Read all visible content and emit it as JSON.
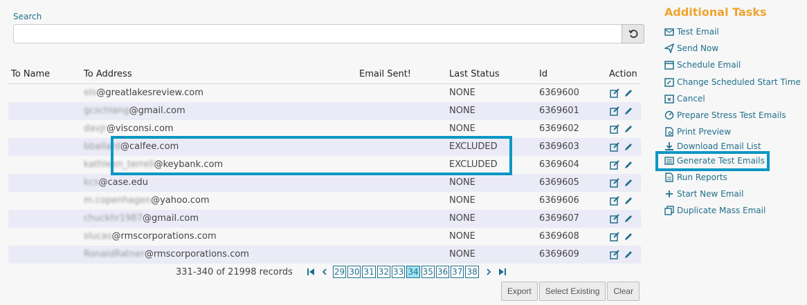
{
  "search": {
    "label": "Search",
    "value": "",
    "placeholder": ""
  },
  "table": {
    "headers": [
      "To Name",
      "To Address",
      "Email Sent!",
      "Last Status",
      "Id",
      "Action"
    ],
    "rows": [
      {
        "name": "",
        "blurred": "els",
        "domain": "@greatlakesreview.com",
        "sent": "",
        "status": "NONE",
        "id": "6369600"
      },
      {
        "name": "",
        "blurred": "gcschlang",
        "domain": "@gmail.com",
        "sent": "",
        "status": "NONE",
        "id": "6369601"
      },
      {
        "name": "",
        "blurred": "davjr",
        "domain": "@visconsi.com",
        "sent": "",
        "status": "NONE",
        "id": "6369602"
      },
      {
        "name": "",
        "blurred": "bballard",
        "domain": "@calfee.com",
        "sent": "",
        "status": "EXCLUDED",
        "id": "6369603"
      },
      {
        "name": "",
        "blurred": "kathleen_terrell",
        "domain": "@keybank.com",
        "sent": "",
        "status": "EXCLUDED",
        "id": "6369604"
      },
      {
        "name": "",
        "blurred": "kcs",
        "domain": "@case.edu",
        "sent": "",
        "status": "NONE",
        "id": "6369605"
      },
      {
        "name": "",
        "blurred": "m.copenhagen",
        "domain": "@yahoo.com",
        "sent": "",
        "status": "NONE",
        "id": "6369606"
      },
      {
        "name": "",
        "blurred": "chuckhr1987",
        "domain": "@gmail.com",
        "sent": "",
        "status": "NONE",
        "id": "6369607"
      },
      {
        "name": "",
        "blurred": "slucas",
        "domain": "@rmscorporations.com",
        "sent": "",
        "status": "NONE",
        "id": "6369608"
      },
      {
        "name": "",
        "blurred": "RonaldRatner",
        "domain": "@rmscorporations.com",
        "sent": "",
        "status": "NONE",
        "id": "6369609"
      }
    ]
  },
  "pager": {
    "records": "331-340 of 21998 records",
    "pages": [
      "29",
      "30",
      "31",
      "32",
      "33",
      "34",
      "35",
      "36",
      "37",
      "38"
    ],
    "active": "34"
  },
  "buttons": {
    "export": "Export",
    "select_existing": "Select Existing",
    "clear": "Clear"
  },
  "tasks": {
    "title": "Additional Tasks",
    "items": [
      {
        "label": "Test Email",
        "icon": "envelope-icon"
      },
      {
        "label": "Send Now",
        "icon": "paper-plane-icon"
      },
      {
        "label": "Schedule Email",
        "icon": "calendar-icon"
      },
      {
        "label": "Change Scheduled Start Time",
        "icon": "calendar-edit-icon"
      },
      {
        "label": "Cancel",
        "icon": "calendar-x-icon"
      },
      {
        "label": "Prepare Stress Test Emails",
        "icon": "gauge-icon"
      },
      {
        "label": "Print Preview",
        "icon": "document-search-icon"
      },
      {
        "label": "Download Email List",
        "icon": "download-icon"
      },
      {
        "label": "Generate Test Emails",
        "icon": "list-icon"
      },
      {
        "label": "Run Reports",
        "icon": "report-icon"
      },
      {
        "label": "Start New Email",
        "icon": "plus-icon"
      },
      {
        "label": "Duplicate Mass Email",
        "icon": "copy-icon"
      }
    ]
  },
  "colors": {
    "accent": "#1f6f8b",
    "title": "#f0a32e",
    "highlight": "#0b97c4"
  }
}
